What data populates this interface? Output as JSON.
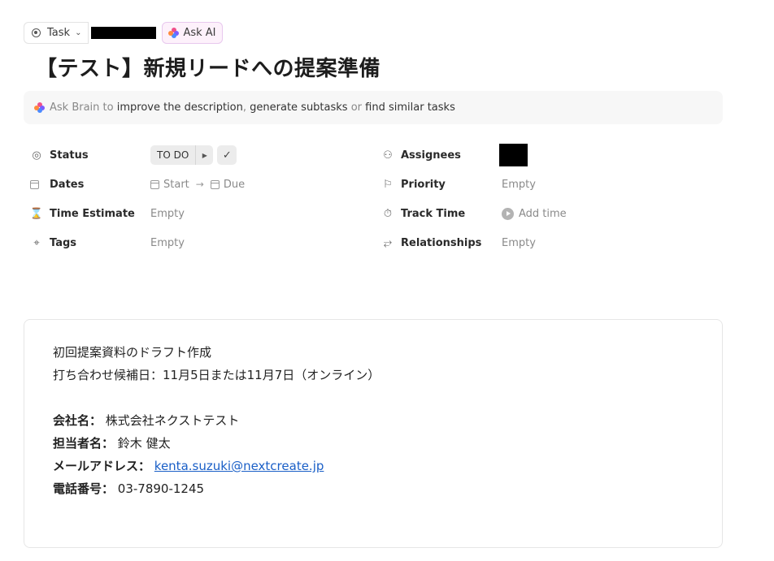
{
  "topbar": {
    "task_label": "Task",
    "ask_ai_label": "Ask AI"
  },
  "title": "【テスト】新規リードへの提案準備",
  "brain": {
    "prefix": "Ask Brain to",
    "action1": "improve the description",
    "sep1": ",",
    "action2": "generate subtasks",
    "sep2": "or",
    "action3": "find similar tasks"
  },
  "fields": {
    "status": {
      "label": "Status",
      "value": "TO DO"
    },
    "dates": {
      "label": "Dates",
      "start": "Start",
      "due": "Due"
    },
    "time_estimate": {
      "label": "Time Estimate",
      "value": "Empty"
    },
    "tags": {
      "label": "Tags",
      "value": "Empty"
    },
    "assignees": {
      "label": "Assignees"
    },
    "priority": {
      "label": "Priority",
      "value": "Empty"
    },
    "track_time": {
      "label": "Track Time",
      "value": "Add time"
    },
    "relationships": {
      "label": "Relationships",
      "value": "Empty"
    }
  },
  "description": {
    "line1": "初回提案資料のドラフト作成",
    "line2": "打ち合わせ候補日：11月5日または11月7日（オンライン）",
    "company_key": "会社名：",
    "company_val": "株式会社ネクストテスト",
    "contact_key": "担当者名：",
    "contact_val": "鈴木 健太",
    "email_key": "メールアドレス：",
    "email_val": "kenta.suzuki@nextcreate.jp",
    "phone_key": "電話番号：",
    "phone_val": "03-7890-1245"
  }
}
